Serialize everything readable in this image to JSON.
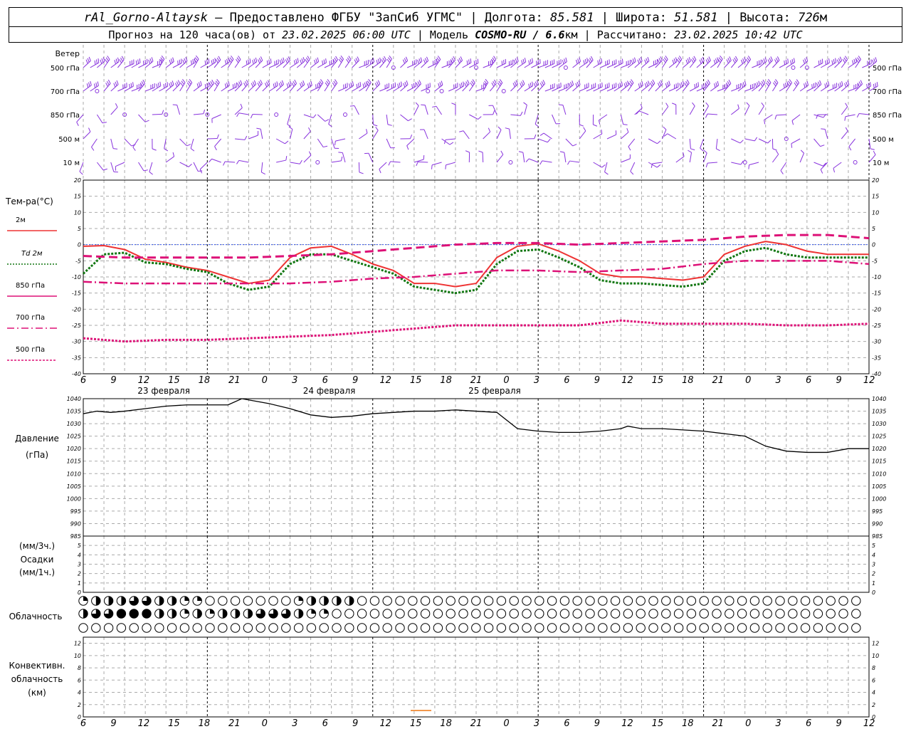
{
  "header": {
    "station": "rAl_Gorno-Altaysk",
    "provider": "Предоставлено ФГБУ \"ЗапСиб УГМС\"",
    "longitude_label": "Долгота:",
    "longitude": "85.581",
    "latitude_label": "Широта:",
    "latitude": "51.581",
    "height_label": "Высота:",
    "height": "726",
    "height_unit": "м",
    "forecast_prefix": "Прогноз на 120 часа(ов) от",
    "forecast_start": "23.02.2025 06:00 UTC",
    "model_label": "Модель",
    "model": "COSMO-RU / 6.6",
    "model_unit": "км",
    "computed_label": "Рассчитано:",
    "computed": "23.02.2025 10:42 UTC"
  },
  "chart_data": {
    "type": "line",
    "time_step_hours": 1,
    "time_ticks": [
      "6",
      "9",
      "12",
      "15",
      "18",
      "21",
      "0",
      "3",
      "6",
      "9",
      "12",
      "15",
      "18",
      "21",
      "0",
      "3",
      "6",
      "9",
      "12",
      "15",
      "18",
      "21",
      "0",
      "3",
      "6",
      "9",
      "12"
    ],
    "dates": [
      "23 февраля",
      "24 февраля",
      "25 февраля"
    ],
    "wind": {
      "label": "Ветер",
      "levels": [
        "500 гПа",
        "700 гПа",
        "850 гПа",
        "500 м",
        "10 м"
      ]
    },
    "temperature": {
      "title": "Тем-ра(°C)",
      "ylim": [
        -40,
        20
      ],
      "yticks": [
        20,
        15,
        10,
        5,
        0,
        -5,
        -10,
        -15,
        -20,
        -25,
        -30,
        -35,
        -40
      ],
      "legend": [
        "2м",
        "Td 2м",
        "850 гПа",
        "700 гПа",
        "500 гПа"
      ],
      "series": [
        {
          "name": "2м",
          "color": "#ee3333",
          "style": "solid",
          "x": [
            0,
            3,
            6,
            9,
            12,
            15,
            18,
            21,
            24,
            27,
            30,
            33,
            36,
            39,
            42,
            45,
            48,
            51,
            54,
            57,
            60,
            63,
            66,
            69,
            72,
            75,
            78,
            81,
            84,
            87,
            90,
            93,
            96,
            99,
            102,
            105,
            108,
            111,
            114
          ],
          "y": [
            -0.5,
            -0.3,
            -1.5,
            -4.5,
            -5.5,
            -7,
            -8,
            -10,
            -12,
            -11,
            -4,
            -1,
            -0.5,
            -3,
            -6,
            -8,
            -12,
            -12,
            -13,
            -12,
            -4,
            -0.5,
            0.3,
            -2,
            -5,
            -9,
            -10,
            -10,
            -10.5,
            -11,
            -10,
            -3,
            -0.5,
            1,
            0,
            -2,
            -3,
            -3,
            -3
          ]
        },
        {
          "name": "Td 2м",
          "color": "#117711",
          "style": "dotted",
          "x": [
            0,
            3,
            6,
            9,
            12,
            15,
            18,
            21,
            24,
            27,
            30,
            33,
            36,
            39,
            42,
            45,
            48,
            51,
            54,
            57,
            60,
            63,
            66,
            69,
            72,
            75,
            78,
            81,
            84,
            87,
            90,
            93,
            96,
            99,
            102,
            105,
            108,
            111,
            114
          ],
          "y": [
            -9,
            -3,
            -2.5,
            -5.5,
            -6,
            -7.5,
            -8.5,
            -12,
            -14,
            -13,
            -6,
            -3,
            -3,
            -5,
            -7,
            -9,
            -13,
            -14,
            -15,
            -14,
            -6,
            -2,
            -1.5,
            -4,
            -7,
            -11,
            -12,
            -12,
            -12.5,
            -13,
            -12,
            -5,
            -2,
            -1,
            -3,
            -4,
            -4,
            -4,
            -4
          ]
        },
        {
          "name": "850 гПа",
          "color": "#dd1177",
          "style": "dashdot",
          "x": [
            0,
            6,
            12,
            18,
            24,
            30,
            36,
            42,
            48,
            54,
            60,
            66,
            72,
            78,
            84,
            90,
            96,
            102,
            108,
            114
          ],
          "y": [
            -11.5,
            -12,
            -12,
            -12,
            -12,
            -12,
            -11.5,
            -10.5,
            -10,
            -9,
            -8,
            -8,
            -8.5,
            -8,
            -7.5,
            -6,
            -5,
            -5,
            -5,
            -6
          ]
        },
        {
          "name": "700 гПа",
          "color": "#dd1177",
          "style": "dashed",
          "x": [
            0,
            6,
            12,
            18,
            24,
            30,
            36,
            42,
            48,
            54,
            60,
            66,
            72,
            78,
            84,
            90,
            96,
            102,
            108,
            114
          ],
          "y": [
            -3.5,
            -4,
            -4,
            -4,
            -4,
            -3.5,
            -3,
            -2,
            -1,
            0,
            0.5,
            0.5,
            0,
            0.5,
            1,
            1.5,
            2.5,
            3,
            3,
            2
          ]
        },
        {
          "name": "500 гПа",
          "color": "#dd1177",
          "style": "dotted",
          "x": [
            0,
            6,
            12,
            18,
            24,
            30,
            36,
            42,
            48,
            54,
            60,
            66,
            72,
            78,
            84,
            90,
            96,
            102,
            108,
            114
          ],
          "y": [
            -29,
            -30,
            -29.5,
            -29.5,
            -29,
            -28.5,
            -28,
            -27,
            -26,
            -25,
            -25,
            -25,
            -25,
            -23.5,
            -24.5,
            -24.5,
            -24.5,
            -25,
            -25,
            -24.5
          ]
        }
      ]
    },
    "pressure": {
      "title": "Давление",
      "unit": "(гПа)",
      "ylim": [
        985,
        1040
      ],
      "yticks": [
        1040,
        1035,
        1030,
        1025,
        1020,
        1015,
        1010,
        1005,
        1000,
        995,
        990,
        985
      ],
      "series": [
        {
          "name": "pressure",
          "color": "#000000",
          "x": [
            0,
            2,
            4,
            6,
            9,
            12,
            15,
            18,
            21,
            23,
            25,
            27,
            30,
            33,
            36,
            39,
            42,
            45,
            48,
            51,
            54,
            57,
            60,
            63,
            66,
            69,
            72,
            75,
            78,
            79,
            81,
            84,
            87,
            90,
            93,
            96,
            99,
            102,
            105,
            108,
            111,
            114
          ],
          "y": [
            1034,
            1035,
            1034.5,
            1035,
            1036,
            1037,
            1037.5,
            1037.5,
            1037.5,
            1040,
            1039,
            1038,
            1036,
            1033.5,
            1032.5,
            1033,
            1034,
            1034.5,
            1035,
            1035,
            1035.5,
            1035,
            1034.5,
            1028,
            1027,
            1026.5,
            1026.5,
            1027,
            1028,
            1029,
            1028,
            1028,
            1027.5,
            1027,
            1026,
            1025,
            1021,
            1019,
            1018.5,
            1018.5,
            1020,
            1020
          ]
        }
      ]
    },
    "precipitation": {
      "title": "Осадки",
      "unit_top": "(мм/3ч.)",
      "unit_bottom": "(мм/1ч.)",
      "yticks": [
        5,
        4,
        3,
        2,
        1,
        0
      ],
      "values": []
    },
    "cloudiness": {
      "title": "Облачность",
      "rows": [
        [
          1,
          2,
          2,
          2,
          3,
          3,
          2,
          2,
          1,
          1,
          0,
          0,
          0,
          0,
          0,
          0,
          0,
          1,
          2,
          2,
          2,
          2,
          0,
          0,
          0,
          0,
          0,
          0,
          0,
          0,
          0,
          0,
          0,
          0,
          0,
          0,
          0,
          0,
          0,
          0,
          0,
          0,
          0,
          0,
          0,
          0,
          0,
          0,
          0,
          0,
          0,
          0,
          0,
          0,
          0,
          0,
          0,
          0,
          0,
          0,
          0,
          0,
          0,
          0,
          0,
          0,
          0,
          0,
          0,
          0,
          0,
          0,
          0,
          0,
          0,
          0,
          0,
          0,
          0,
          0,
          0,
          0,
          0,
          0,
          0,
          0,
          0,
          0,
          0,
          0,
          0,
          0,
          0,
          0,
          0,
          0,
          0,
          0,
          0,
          0,
          0,
          0,
          0,
          0,
          0,
          0,
          0,
          0,
          0,
          0,
          0,
          0,
          0,
          0,
          0
        ],
        [
          2,
          3,
          3,
          4,
          4,
          4,
          2,
          2,
          1,
          2,
          1,
          2,
          2,
          2,
          3,
          3,
          3,
          2,
          1,
          1,
          0,
          0,
          0,
          0,
          0,
          0,
          0,
          0,
          0,
          0,
          0,
          0,
          0,
          0,
          0,
          0,
          0,
          0,
          0,
          0,
          0,
          0,
          0,
          0,
          0,
          0,
          0,
          0,
          0,
          0,
          0,
          0,
          0,
          0,
          0,
          0,
          0,
          0,
          0,
          0,
          0,
          0,
          0,
          0,
          0,
          0,
          0,
          0,
          0,
          0,
          0,
          0,
          0,
          0,
          0,
          0,
          0,
          0,
          0,
          0,
          0,
          0,
          0,
          0,
          0,
          0,
          0,
          0,
          0,
          0,
          0,
          0,
          0,
          0,
          0,
          0,
          0,
          0,
          0,
          0,
          0,
          0,
          0,
          0,
          0,
          0,
          0,
          0,
          0,
          0,
          0,
          0,
          0,
          0,
          0
        ],
        [
          0,
          0,
          0,
          0,
          0,
          0,
          0,
          0,
          0,
          0,
          0,
          0,
          0,
          0,
          0,
          0,
          0,
          0,
          0,
          0,
          0,
          0,
          0,
          0,
          0,
          0,
          0,
          0,
          0,
          0,
          0,
          0,
          0,
          0,
          0,
          0,
          0,
          0,
          0,
          0,
          0,
          0,
          0,
          0,
          0,
          0,
          0,
          0,
          0,
          0,
          0,
          0,
          0,
          0,
          0,
          0,
          0,
          0,
          0,
          0,
          0,
          0,
          0,
          0,
          0,
          0,
          0,
          0,
          0,
          0,
          0,
          0,
          0,
          0,
          0,
          0,
          0,
          0,
          0,
          0,
          0,
          0,
          0,
          0,
          0,
          0,
          0,
          0,
          0,
          0,
          0,
          0,
          0,
          0,
          0,
          0,
          0,
          0,
          0,
          0,
          0,
          0,
          0,
          0,
          0,
          0,
          0,
          0,
          0,
          0,
          0,
          0,
          0,
          0,
          0
        ]
      ]
    },
    "convective": {
      "title": "Конвективн. облачность",
      "unit": "(км)",
      "yticks": [
        12,
        10,
        8,
        6,
        4,
        2,
        0
      ],
      "ylim": [
        0,
        13
      ]
    }
  }
}
